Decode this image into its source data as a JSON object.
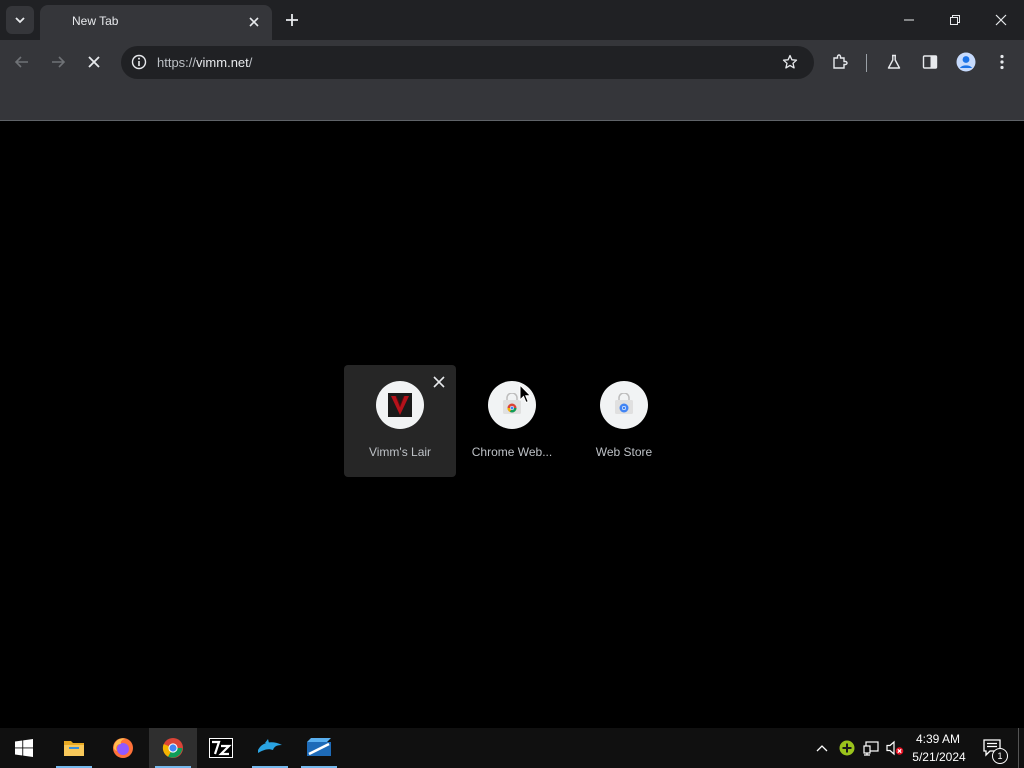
{
  "browser": {
    "tab_title": "New Tab",
    "url_scheme": "https://",
    "url_host": "vimm.net",
    "url_path": "/"
  },
  "shortcuts": [
    {
      "label": "Vimm's Lair",
      "icon": "vimm-logo-icon"
    },
    {
      "label": "Chrome Web...",
      "icon": "chrome-web-store-icon"
    },
    {
      "label": "Web Store",
      "icon": "chrome-web-store-icon"
    }
  ],
  "taskbar": {
    "time": "4:39 AM",
    "date": "5/21/2024",
    "notification_count": "1"
  },
  "colors": {
    "page_bg": "#000000",
    "toolbar_bg": "#35363a",
    "tabstrip_bg": "#202124",
    "accent": "#76b9ed",
    "vimm_red": "#b5121b"
  }
}
